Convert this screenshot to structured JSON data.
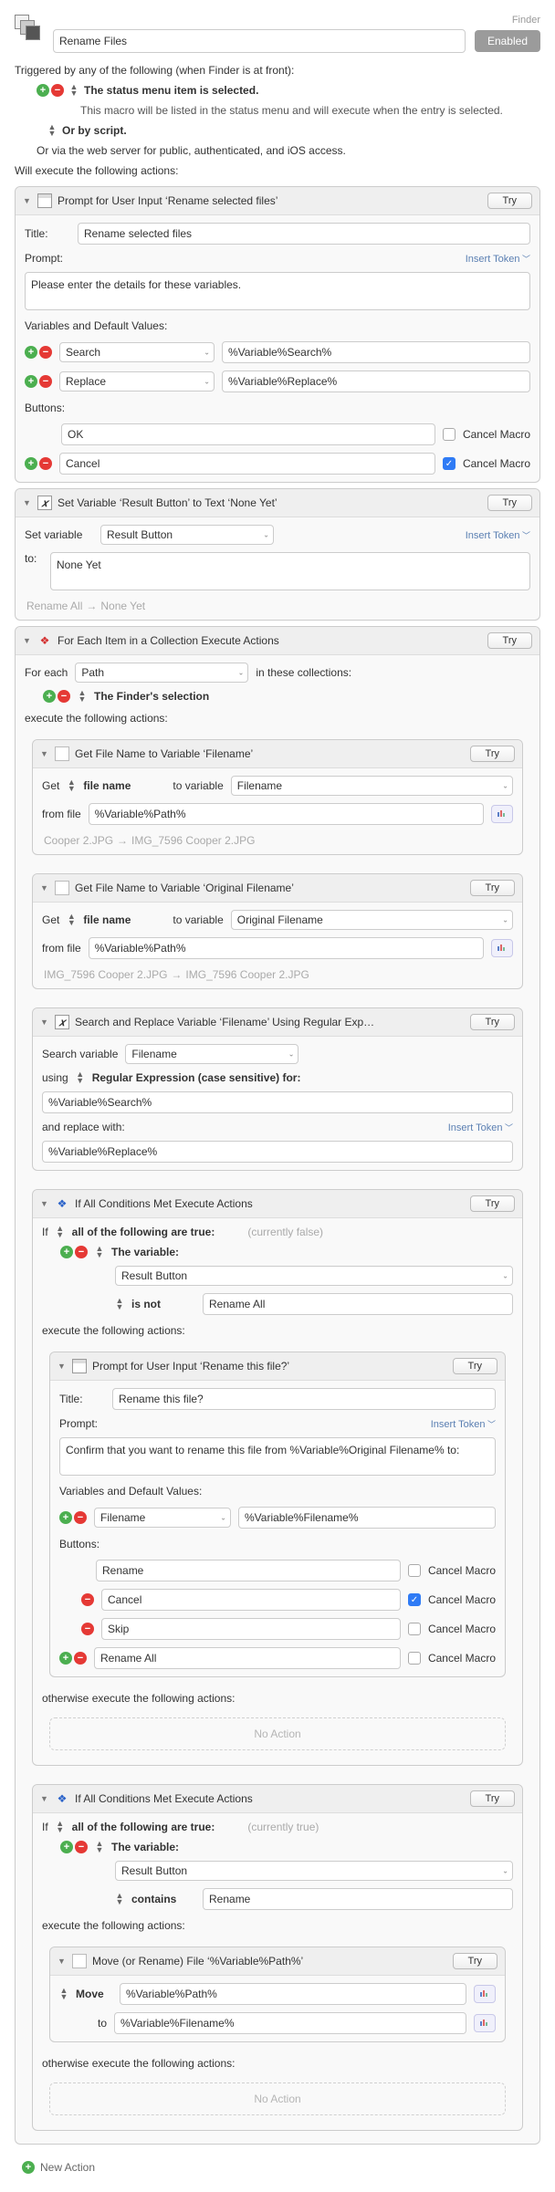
{
  "app_hint": "Finder",
  "macro_name": "Rename Files",
  "enabled_label": "Enabled",
  "trigger_intro": "Triggered by any of the following (when Finder is at front):",
  "trigger_status_menu": "The status menu item is selected.",
  "trigger_status_desc": "This macro will be listed in the status menu and will execute when the entry is selected.",
  "or_by_script": "Or by script.",
  "or_via_web": "Or via the web server for public, authenticated, and iOS access.",
  "will_execute": "Will execute the following actions:",
  "try_label": "Try",
  "insert_token": "Insert Token",
  "cancel_macro_label": "Cancel Macro",
  "prompt1": {
    "title": "Prompt for User Input ‘Rename selected files’",
    "title_label": "Title:",
    "title_value": "Rename selected files",
    "prompt_label": "Prompt:",
    "prompt_value": "Please enter the details for these variables.",
    "vars_label": "Variables and Default Values:",
    "vars": [
      {
        "name": "Search",
        "default": "%Variable%Search%"
      },
      {
        "name": "Replace",
        "default": "%Variable%Replace%"
      }
    ],
    "buttons_label": "Buttons:",
    "buttons": [
      {
        "name": "OK",
        "cancel": false,
        "has_pm": false
      },
      {
        "name": "Cancel",
        "cancel": true,
        "has_pm": true
      }
    ]
  },
  "setvar": {
    "title": "Set Variable ‘Result Button’ to Text ‘None Yet’",
    "label": "Set variable",
    "var": "Result Button",
    "to_label": "to:",
    "value": "None Yet",
    "preview_from": "Rename All",
    "preview_to": "None Yet"
  },
  "foreach": {
    "title": "For Each Item in a Collection Execute Actions",
    "for_each_label": "For each",
    "var": "Path",
    "in_colls": "in these collections:",
    "collection": "The Finder's selection",
    "execute_label": "execute the following actions:"
  },
  "get1": {
    "title": "Get File Name to Variable ‘Filename’",
    "get_label": "Get",
    "attr": "file name",
    "to_var_label": "to variable",
    "var": "Filename",
    "from_file_label": "from file",
    "from_file": "%Variable%Path%",
    "preview_from": "Cooper 2.JPG",
    "preview_to": "IMG_7596 Cooper 2.JPG"
  },
  "get2": {
    "title": "Get File Name to Variable ‘Original Filename’",
    "get_label": "Get",
    "attr": "file name",
    "to_var_label": "to variable",
    "var": "Original Filename",
    "from_file_label": "from file",
    "from_file": "%Variable%Path%",
    "preview_from": "IMG_7596 Cooper 2.JPG",
    "preview_to": "IMG_7596 Cooper 2.JPG"
  },
  "sr": {
    "title": "Search and Replace Variable ‘Filename’ Using Regular Exp…",
    "search_var_label": "Search variable",
    "var": "Filename",
    "using_label": "using",
    "using_mode": "Regular Expression (case sensitive) for:",
    "search_for": "%Variable%Search%",
    "replace_label": "and replace with:",
    "replace_with": "%Variable%Replace%"
  },
  "if1": {
    "title": "If All Conditions Met Execute Actions",
    "if_label": "If",
    "mode": "all of the following are true:",
    "state": "(currently false)",
    "the_variable": "The variable:",
    "var": "Result Button",
    "op": "is not",
    "value": "Rename All",
    "execute_label": "execute the following actions:",
    "otherwise_label": "otherwise execute the following actions:",
    "no_action": "No Action"
  },
  "prompt2": {
    "title": "Prompt for User Input ‘Rename this file?’",
    "title_label": "Title:",
    "title_value": "Rename this file?",
    "prompt_label": "Prompt:",
    "prompt_value": "Confirm that you want to rename this file from %Variable%Original Filename% to:",
    "vars_label": "Variables and Default Values:",
    "vars": [
      {
        "name": "Filename",
        "default": "%Variable%Filename%"
      }
    ],
    "buttons_label": "Buttons:",
    "buttons": [
      {
        "name": "Rename",
        "cancel": false,
        "pm": ""
      },
      {
        "name": "Cancel",
        "cancel": true,
        "pm": "minus"
      },
      {
        "name": "Skip",
        "cancel": false,
        "pm": "minus"
      },
      {
        "name": "Rename All",
        "cancel": false,
        "pm": "both"
      }
    ]
  },
  "if2": {
    "title": "If All Conditions Met Execute Actions",
    "if_label": "If",
    "mode": "all of the following are true:",
    "state": "(currently true)",
    "the_variable": "The variable:",
    "var": "Result Button",
    "op": "contains",
    "value": "Rename",
    "execute_label": "execute the following actions:",
    "otherwise_label": "otherwise execute the following actions:",
    "no_action": "No Action"
  },
  "move": {
    "title": "Move (or Rename) File ‘%Variable%Path%’",
    "op": "Move",
    "src": "%Variable%Path%",
    "to_label": "to",
    "dst": "%Variable%Filename%"
  },
  "new_action": "New Action"
}
